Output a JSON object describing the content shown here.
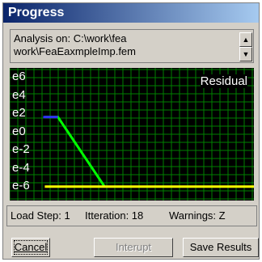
{
  "window": {
    "title": "Progress"
  },
  "analysis": {
    "line1": "Analysis on: C:\\work\\fea",
    "line2": "work\\FeaEaxmpleImp.fem"
  },
  "chart_data": {
    "type": "line",
    "title": "",
    "legend": "Residual",
    "y_tick_labels": [
      "e6",
      "e4",
      "e2",
      "e0",
      "e-2",
      "e-4",
      "e-6"
    ],
    "ylim": [
      -7,
      7
    ],
    "xlim": [
      0,
      18
    ],
    "grid": true,
    "series": [
      {
        "name": "Residual",
        "color": "#00ff00",
        "x": [
          0.5,
          1.6,
          5.5
        ],
        "y": [
          2,
          2,
          -6.3
        ]
      },
      {
        "name": "",
        "color": "#ffff00",
        "x": [
          0.5,
          18
        ],
        "y": [
          -6.3,
          -6.3
        ]
      }
    ]
  },
  "status": {
    "load_step": "Load Step: 1",
    "iteration": "Itteration: 18",
    "warnings": "Warnings: Z"
  },
  "buttons": {
    "cancel": "Cancel",
    "interrupt": "Interupt",
    "save": "Save Results"
  },
  "colors": {
    "title_start": "#0a246a",
    "title_end": "#a6caf0",
    "grid": "#008000",
    "residual": "#00ff00",
    "threshold": "#ffff00"
  }
}
